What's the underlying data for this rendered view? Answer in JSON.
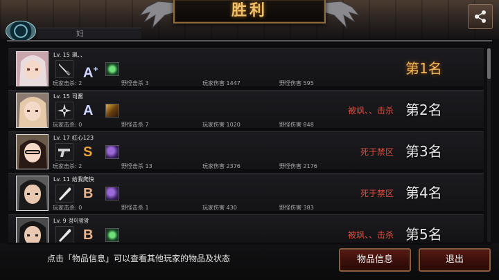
{
  "header": {
    "title": "胜利"
  },
  "corner": {
    "name_partial": "妇"
  },
  "colors": {
    "title_gold": "#f0c06a",
    "first_place": "#f5b85a",
    "death_red": "#e04a3a",
    "grade_a": "#cfd6ff",
    "grade_s": "#e8a23a",
    "grade_b": "#e8b28a"
  },
  "players": [
    {
      "level": "Lv. 15",
      "name": "飒、、",
      "weapon_icon": "knife-icon",
      "grade": "A",
      "grade_sup": "+",
      "item_icon": "green-gem-icon",
      "player_kills_label": "玩家击杀: 2",
      "monster_kills_label": "野怪击杀 3",
      "player_damage_label": "玩家伤害 1447",
      "monster_damage_label": "野怪伤害 595",
      "death": "",
      "rank": "第1名"
    },
    {
      "level": "Lv. 15",
      "name": "司酱",
      "weapon_icon": "shuriken-icon",
      "grade": "A",
      "grade_sup": "",
      "item_icon": "gold-scroll-icon",
      "player_kills_label": "玩家击杀: 0",
      "monster_kills_label": "野怪击杀 7",
      "player_damage_label": "玩家伤害 1020",
      "monster_damage_label": "野怪伤害 848",
      "death": "被飒、、击杀",
      "rank": "第2名"
    },
    {
      "level": "Lv. 17",
      "name": "红心123",
      "weapon_icon": "pistol-icon",
      "grade": "S",
      "grade_sup": "",
      "item_icon": "purple-creature-icon",
      "player_kills_label": "玩家击杀: 2",
      "monster_kills_label": "野怪击杀 13",
      "player_damage_label": "玩家伤害 2376",
      "monster_damage_label": "野怪伤害 2176",
      "death": "死于禁区",
      "rank": "第3名"
    },
    {
      "level": "Lv. 11",
      "name": "给我爬快",
      "weapon_icon": "bat-icon",
      "grade": "B",
      "grade_sup": "",
      "item_icon": "purple-creature-icon",
      "player_kills_label": "玩家击杀: 0",
      "monster_kills_label": "野怪击杀 1",
      "player_damage_label": "玩家伤害 430",
      "monster_damage_label": "野怪伤害 383",
      "death": "死于禁区",
      "rank": "第4名"
    },
    {
      "level": "Lv. 9",
      "name": "정이짱짱",
      "weapon_icon": "bat-icon",
      "grade": "B",
      "grade_sup": "",
      "item_icon": "green-gem-icon",
      "player_kills_label": "",
      "monster_kills_label": "",
      "player_damage_label": "",
      "monster_damage_label": "",
      "death": "被飒、、击杀",
      "rank": "第5名"
    }
  ],
  "footer": {
    "hint": "点击「物品信息」可以查看其他玩家的物品及状态",
    "info_button": "物品信息",
    "exit_button": "退出"
  }
}
